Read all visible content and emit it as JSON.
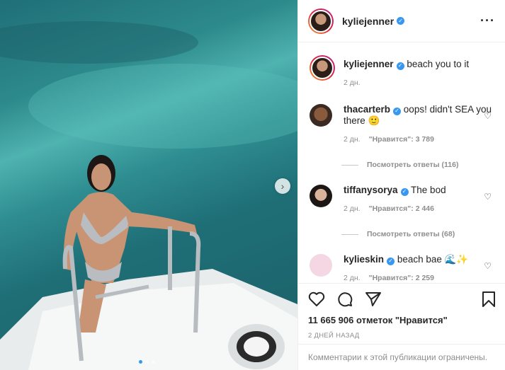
{
  "post": {
    "author": "kyliejenner",
    "caption_text": "beach you to it",
    "caption_time": "2 дн.",
    "likes_total": "11 665 906 отметок \"Нравится\"",
    "date": "2 ДНЕЙ НАЗАД",
    "comments_disabled": "Комментарии к этой публикации ограничены.",
    "carousel_index": 1,
    "carousel_count": 3
  },
  "comments": [
    {
      "user": "thacarterb",
      "text": "oops! didn't SEA you there 🙂",
      "time": "2 дн.",
      "likes": "\"Нравится\": 3 789",
      "replies": "Посмотреть ответы (116)"
    },
    {
      "user": "tiffanysorya",
      "text": "The bod",
      "time": "2 дн.",
      "likes": "\"Нравится\": 2 446",
      "replies": "Посмотреть ответы (68)"
    },
    {
      "user": "kylieskin",
      "text": "beach bae 🌊✨",
      "time": "2 дн.",
      "likes": "\"Нравится\": 2 259"
    }
  ],
  "colors": {
    "verified": "#3897f0",
    "muted": "#8e8e8e",
    "sea": "#2d8a8c"
  },
  "icons": {
    "more": "more-horizontal-icon",
    "next": "chevron-right-icon",
    "like": "heart-icon",
    "comment": "comment-icon",
    "share": "paper-plane-icon",
    "save": "bookmark-icon"
  }
}
